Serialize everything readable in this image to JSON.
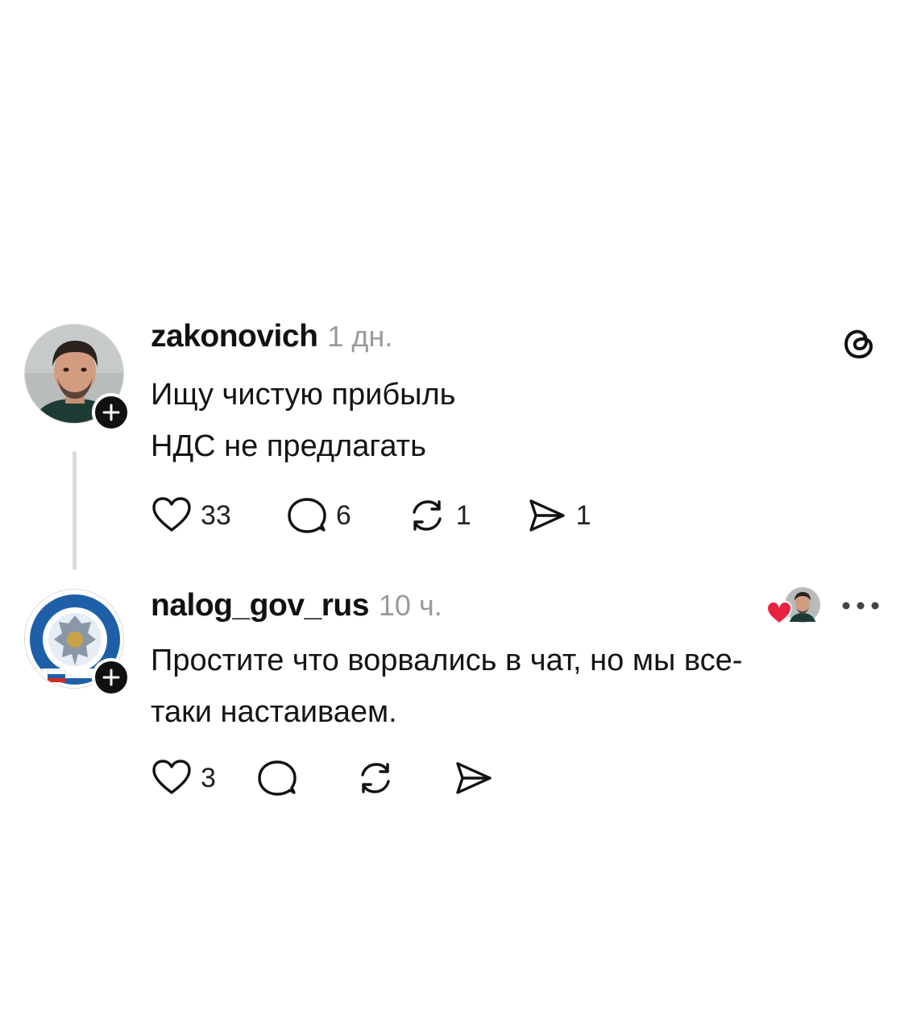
{
  "posts": [
    {
      "username": "zakonovich",
      "time": "1 дн.",
      "lines": [
        "Ищу чистую прибыль",
        "НДС не предлагать"
      ],
      "likes": "33",
      "replies": "6",
      "reposts": "1",
      "shares": "1"
    },
    {
      "username": "nalog_gov_rus",
      "time": "10 ч.",
      "lines": [
        "Простите что ворвались в чат, но мы все-",
        "таки настаиваем."
      ],
      "likes": "3",
      "replies": "",
      "reposts": "",
      "shares": ""
    }
  ],
  "icons": {
    "app_logo": "threads-logo-icon",
    "follow": "plus-icon",
    "like": "heart-icon",
    "reply": "comment-bubble-icon",
    "repost": "repost-icon",
    "share": "send-icon",
    "liked_by": "liked-by-avatar-icon",
    "more": "more-options-icon"
  },
  "colors": {
    "text": "#141414",
    "muted": "#9a9a9a",
    "like_red": "#e8233f"
  }
}
